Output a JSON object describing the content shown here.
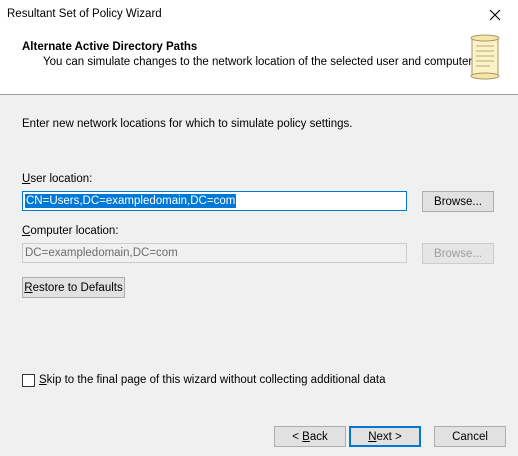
{
  "window": {
    "title": "Resultant Set of Policy Wizard"
  },
  "header": {
    "title": "Alternate Active Directory Paths",
    "subtitle": "You can simulate changes to the network location of the selected user and computer."
  },
  "intro": "Enter new network locations for which to simulate policy settings.",
  "user_location": {
    "label_hotkey": "U",
    "label_rest": "ser location:",
    "value": "CN=Users,DC=exampledomain,DC=com",
    "browse_label": "Browse..."
  },
  "computer_location": {
    "label_hotkey": "C",
    "label_rest": "omputer location:",
    "value": "DC=exampledomain,DC=com",
    "browse_label": "Browse..."
  },
  "restore": {
    "hotkey": "R",
    "rest": "estore to Defaults"
  },
  "skip": {
    "hotkey": "S",
    "rest": "kip to the final page of this wizard without collecting additional data",
    "checked": false
  },
  "footer": {
    "back_prefix": "< ",
    "back_hotkey": "B",
    "back_rest": "ack",
    "next_hotkey": "N",
    "next_rest": "ext >",
    "cancel": "Cancel"
  },
  "colors": {
    "accent": "#0078d7",
    "background": "#f0f0f0"
  }
}
